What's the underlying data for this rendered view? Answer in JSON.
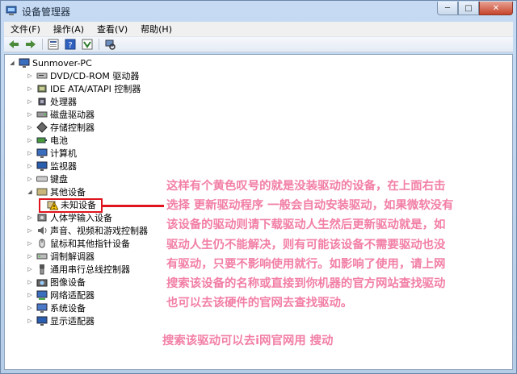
{
  "window": {
    "title": "设备管理器",
    "caption": {
      "minimize": "─",
      "maximize": "□",
      "close": "✕"
    }
  },
  "menu": [
    "文件(F)",
    "操作(A)",
    "查看(V)",
    "帮助(H)"
  ],
  "toolbar_icons": [
    "back-arrow-icon",
    "forward-arrow-icon",
    "properties-icon",
    "help-icon",
    "update-driver-icon",
    "scan-hardware-icon"
  ],
  "tree": {
    "root": "Sunmover-PC",
    "items": [
      {
        "label": "DVD/CD-ROM 驱动器",
        "icon": "dvd-drive-icon"
      },
      {
        "label": "IDE ATA/ATAPI 控制器",
        "icon": "ide-controller-icon"
      },
      {
        "label": "处理器",
        "icon": "processor-icon"
      },
      {
        "label": "磁盘驱动器",
        "icon": "disk-drive-icon"
      },
      {
        "label": "存储控制器",
        "icon": "storage-controller-icon"
      },
      {
        "label": "电池",
        "icon": "battery-icon"
      },
      {
        "label": "计算机",
        "icon": "computer-icon"
      },
      {
        "label": "监视器",
        "icon": "monitor-icon"
      },
      {
        "label": "键盘",
        "icon": "keyboard-icon"
      },
      {
        "label": "其他设备",
        "icon": "other-devices-icon",
        "expanded": true
      },
      {
        "label": "未知设备",
        "icon": "warning-device-icon",
        "child": true
      },
      {
        "label": "人体学输入设备",
        "icon": "hid-icon"
      },
      {
        "label": "声音、视频和游戏控制器",
        "icon": "sound-icon"
      },
      {
        "label": "鼠标和其他指针设备",
        "icon": "mouse-icon"
      },
      {
        "label": "调制解调器",
        "icon": "modem-icon"
      },
      {
        "label": "通用串行总线控制器",
        "icon": "usb-icon"
      },
      {
        "label": "图像设备",
        "icon": "imaging-icon"
      },
      {
        "label": "网络适配器",
        "icon": "network-adapter-icon"
      },
      {
        "label": "系统设备",
        "icon": "system-device-icon"
      },
      {
        "label": "显示适配器",
        "icon": "display-adapter-icon"
      }
    ]
  },
  "annotation": {
    "lines": [
      "这样有个黄色叹号的就是没装驱动的设备，在上面右击",
      "选择 更新驱动程序 一般会自动安装驱动，如果微软没有",
      "该设备的驱动则请下载驱动人生然后更新驱动就是，如",
      "驱动人生仍不能解决，则有可能该设备不需要驱动也没",
      "有驱动，只要不影响使用就行。如影响了使用，请上网",
      "搜索该设备的名称或直接到你机器的官方网站查找驱动",
      "也可以去该硬件的官网去查找驱动。"
    ],
    "footer": "搜索该驱动可以去i网官网用    搜动"
  },
  "colors": {
    "annotation": "#f27fa6",
    "highlight": "#e0141e"
  }
}
